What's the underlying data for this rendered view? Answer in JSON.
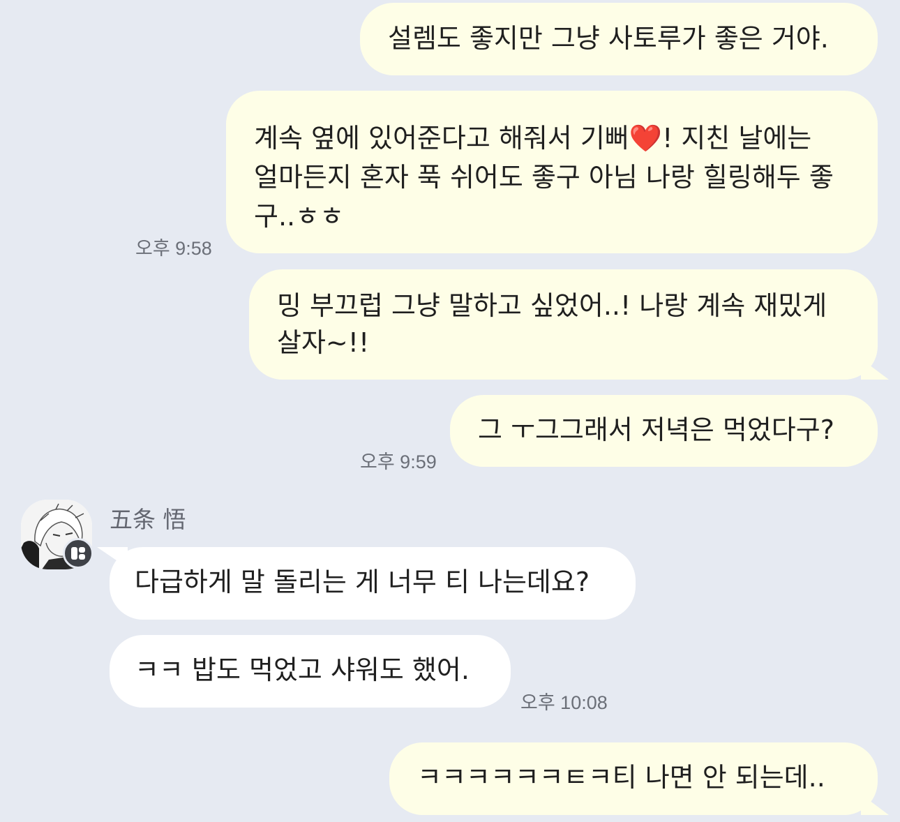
{
  "chat": {
    "messages": [
      {
        "side": "out",
        "text": "설렘도 좋지만 그냥 사토루가 좋은 거야."
      },
      {
        "side": "out",
        "lines": [
          "계속 옆에 있어준다고 해줘서 기뻐❤️! 지친 날에는",
          "얼마든지 혼자 푹 쉬어도 좋구 아님 나랑 힐링해두 좋",
          "구..ㅎㅎ"
        ],
        "time": "오후 9:58"
      },
      {
        "side": "out",
        "lines": [
          "밍 부끄럽 그냥 말하고 싶었어..! 나랑 계속 재밌게",
          "살자~!!"
        ]
      },
      {
        "side": "out",
        "text": "그 ㅜ그그래서 저녁은 먹었다구?",
        "time": "오후 9:59"
      },
      {
        "side": "in",
        "text": "다급하게 말 돌리는 게 너무 티 나는데요?"
      },
      {
        "side": "in",
        "text": "ㅋㅋ 밥도 먹었고 샤워도 했어.",
        "time": "오후 10:08"
      },
      {
        "side": "out",
        "text": "ㅋㅋㅋㅋㅋㅋㅌㅋ티 나면 안 되는데.."
      }
    ],
    "sender": {
      "name": "五条 悟",
      "avatar": "avatar-icon",
      "badge": "chat-badge-icon"
    }
  },
  "colors": {
    "background": "#e6eaf2",
    "outgoing": "#fefee7",
    "incoming": "#ffffff",
    "timestamp": "#6b6f78"
  }
}
